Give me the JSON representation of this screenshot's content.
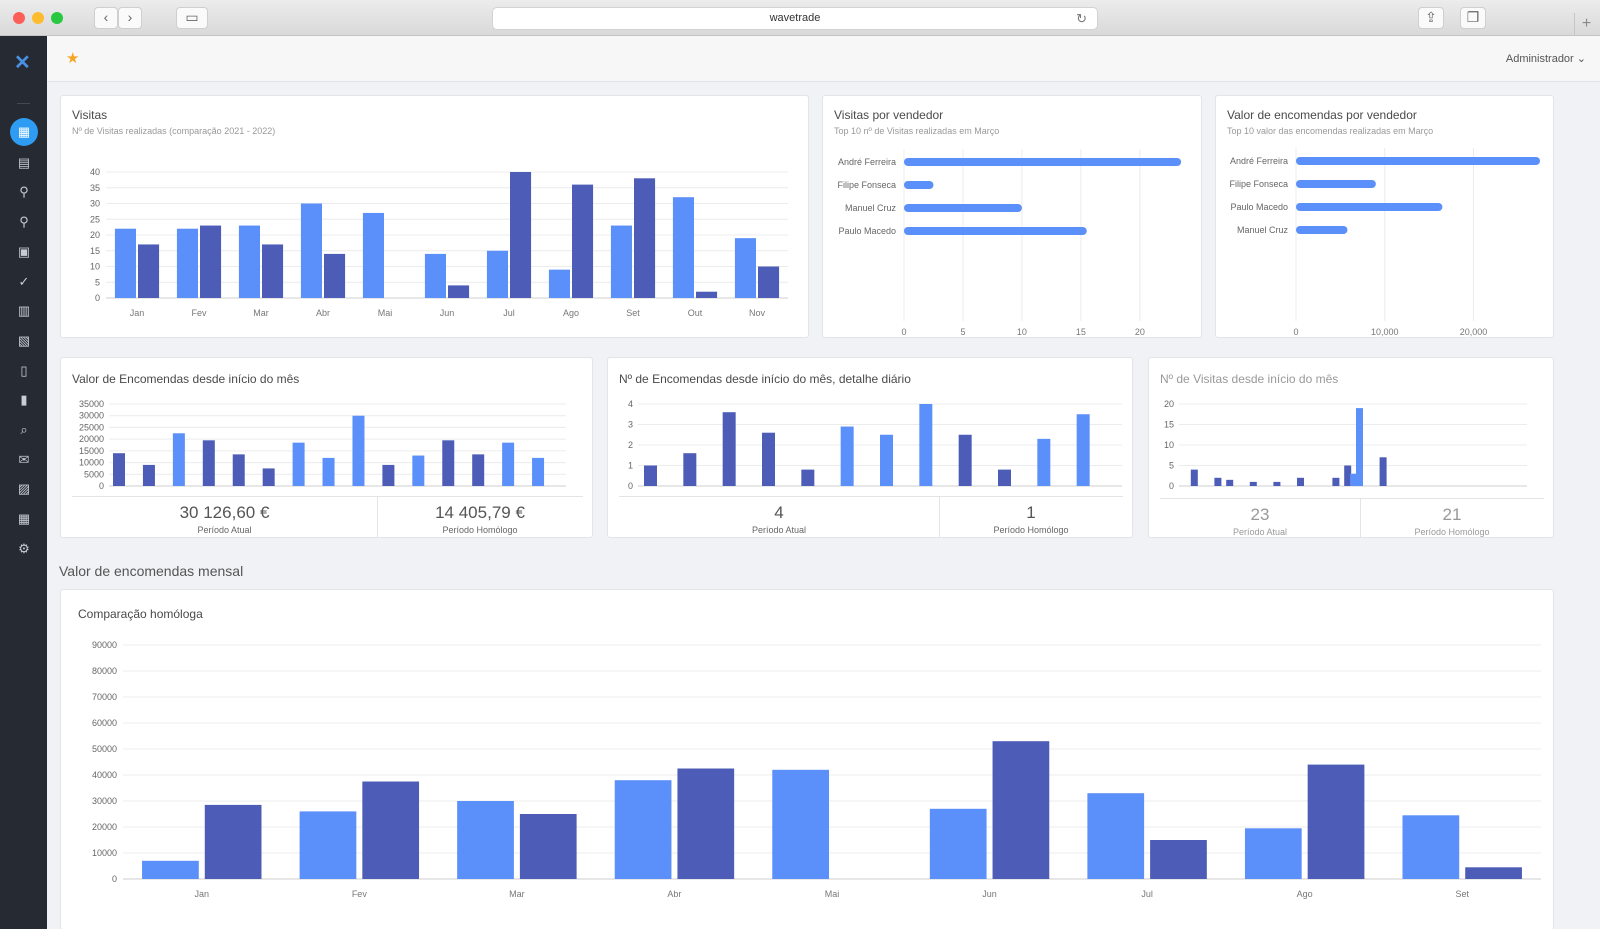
{
  "browser": {
    "url": "wavetrade"
  },
  "header": {
    "admin_label": "Administrador"
  },
  "colors": {
    "light": "#5b8ff9",
    "dark": "#4d5cb6",
    "accent": "#2e9cf2"
  },
  "sidebar": {
    "icons": [
      "dashboard-icon",
      "contacts-icon",
      "map-pin-icon",
      "location-icon",
      "calendar-icon",
      "check-icon",
      "briefcase-icon",
      "address-book-icon",
      "document-icon",
      "mobile-export-icon",
      "search-icon",
      "mail-icon",
      "report-icon",
      "table-icon",
      "settings-icon"
    ]
  },
  "visitas": {
    "title": "Visitas",
    "subtitle": "Nº de Visitas realizadas (comparação 2021 - 2022)",
    "chart_data": {
      "type": "bar",
      "categories": [
        "Jan",
        "Fev",
        "Mar",
        "Abr",
        "Mai",
        "Jun",
        "Jul",
        "Ago",
        "Set",
        "Out",
        "Nov"
      ],
      "series": [
        {
          "values": [
            22,
            22,
            23,
            30,
            27,
            14,
            15,
            9,
            23,
            32,
            19
          ]
        },
        {
          "values": [
            17,
            23,
            17,
            14,
            null,
            4,
            40,
            36,
            38,
            2,
            10
          ]
        }
      ],
      "ylim": [
        0,
        40
      ],
      "yticks": [
        0,
        5,
        10,
        15,
        20,
        25,
        30,
        35,
        40
      ]
    }
  },
  "visitas_vendedor": {
    "title": "Visitas por vendedor",
    "subtitle": "Top 10 nº de Visitas realizadas em Março",
    "chart_data": {
      "type": "bar",
      "categories": [
        "André Ferreira",
        "Filipe Fonseca",
        "Manuel Cruz",
        "Paulo Macedo"
      ],
      "values": [
        23.5,
        2.5,
        10,
        15.5
      ],
      "xlim": [
        0,
        24
      ],
      "xticks": [
        0,
        5,
        10,
        15,
        20
      ]
    }
  },
  "valor_vendedor": {
    "title": "Valor de encomendas por vendedor",
    "subtitle": "Top 10 valor das encomendas realizadas em Março",
    "chart_data": {
      "type": "bar",
      "categories": [
        "André Ferreira",
        "Filipe Fonseca",
        "Paulo Macedo",
        "Manuel Cruz"
      ],
      "values": [
        27500,
        9000,
        16500,
        5800
      ],
      "xlim": [
        0,
        27500
      ],
      "xticks": [
        0,
        10000,
        20000
      ],
      "xtick_labels": [
        "0",
        "10,000",
        "20,000"
      ]
    }
  },
  "valor_mes": {
    "title": "Valor de Encomendas desde início do mês",
    "chart_data": {
      "type": "bar",
      "bars": [
        {
          "v": 14000,
          "s": 1
        },
        {
          "v": 9000,
          "s": 1
        },
        {
          "v": 22500,
          "s": 0
        },
        {
          "v": 19500,
          "s": 1
        },
        {
          "v": 13500,
          "s": 1
        },
        {
          "v": 7500,
          "s": 1
        },
        {
          "v": 18500,
          "s": 0
        },
        {
          "v": 12000,
          "s": 0
        },
        {
          "v": 30000,
          "s": 0
        },
        {
          "v": 9000,
          "s": 1
        },
        {
          "v": 13000,
          "s": 0
        },
        {
          "v": 19500,
          "s": 1
        },
        {
          "v": 13500,
          "s": 1
        },
        {
          "v": 18500,
          "s": 0
        },
        {
          "v": 12000,
          "s": 0
        }
      ],
      "ylim": [
        0,
        35000
      ],
      "yticks": [
        0,
        5000,
        10000,
        15000,
        20000,
        25000,
        30000,
        35000
      ]
    },
    "current": "30 126,60 €",
    "current_label": "Período Atual",
    "previous": "14 405,79 €",
    "previous_label": "Período Homólogo"
  },
  "num_mes": {
    "title": "Nº de Encomendas desde início do mês, detalhe diário",
    "chart_data": {
      "type": "bar",
      "bars": [
        {
          "v": 1,
          "s": 1
        },
        {
          "v": 1.6,
          "s": 1
        },
        {
          "v": 3.6,
          "s": 1
        },
        {
          "v": 2.6,
          "s": 1
        },
        {
          "v": 0.8,
          "s": 1
        },
        {
          "v": 2.9,
          "s": 0
        },
        {
          "v": 2.5,
          "s": 0
        },
        {
          "v": 4,
          "s": 0
        },
        {
          "v": 2.5,
          "s": 1
        },
        {
          "v": 0.8,
          "s": 1
        },
        {
          "v": 2.3,
          "s": 0
        },
        {
          "v": 3.5,
          "s": 0
        }
      ],
      "ylim": [
        0,
        4
      ],
      "yticks": [
        0,
        1,
        2,
        3,
        4
      ]
    },
    "current": "4",
    "current_label": "Período Atual",
    "previous": "1",
    "previous_label": "Período Homólogo"
  },
  "visitas_mes": {
    "title": "Nº de Visitas desde início do mês",
    "chart_data": {
      "type": "bar",
      "bars": [
        {
          "day": 1,
          "v": 4,
          "s": 1
        },
        {
          "day": 3,
          "v": 2,
          "s": 1
        },
        {
          "day": 4,
          "v": 1.5,
          "s": 1
        },
        {
          "day": 6,
          "v": 1,
          "s": 1
        },
        {
          "day": 8,
          "v": 1,
          "s": 1
        },
        {
          "day": 10,
          "v": 2,
          "s": 1
        },
        {
          "day": 13,
          "v": 2,
          "s": 1
        },
        {
          "day": 14,
          "v": 5,
          "s": 1
        },
        {
          "day": 14.5,
          "v": 3,
          "s": 0
        },
        {
          "day": 15,
          "v": 19,
          "s": 0
        },
        {
          "day": 17,
          "v": 7,
          "s": 1
        }
      ],
      "ylim": [
        0,
        20
      ],
      "yticks": [
        0,
        5,
        10,
        15,
        20
      ]
    },
    "current": "23",
    "current_label": "Período Atual",
    "previous": "21",
    "previous_label": "Período Homólogo"
  },
  "mensal": {
    "section_title": "Valor de encomendas mensal",
    "title": "Comparação homóloga",
    "chart_data": {
      "type": "bar",
      "categories": [
        "Jan",
        "Fev",
        "Mar",
        "Abr",
        "Mai",
        "Jun",
        "Jul",
        "Ago",
        "Set"
      ],
      "series": [
        {
          "values": [
            7000,
            26000,
            30000,
            38000,
            42000,
            27000,
            33000,
            19500,
            24500
          ]
        },
        {
          "values": [
            28500,
            37500,
            25000,
            42500,
            null,
            53000,
            15000,
            44000,
            4500
          ]
        }
      ],
      "ylim": [
        0,
        90000
      ],
      "yticks": [
        0,
        10000,
        20000,
        30000,
        40000,
        50000,
        60000,
        70000,
        80000,
        90000
      ]
    }
  }
}
